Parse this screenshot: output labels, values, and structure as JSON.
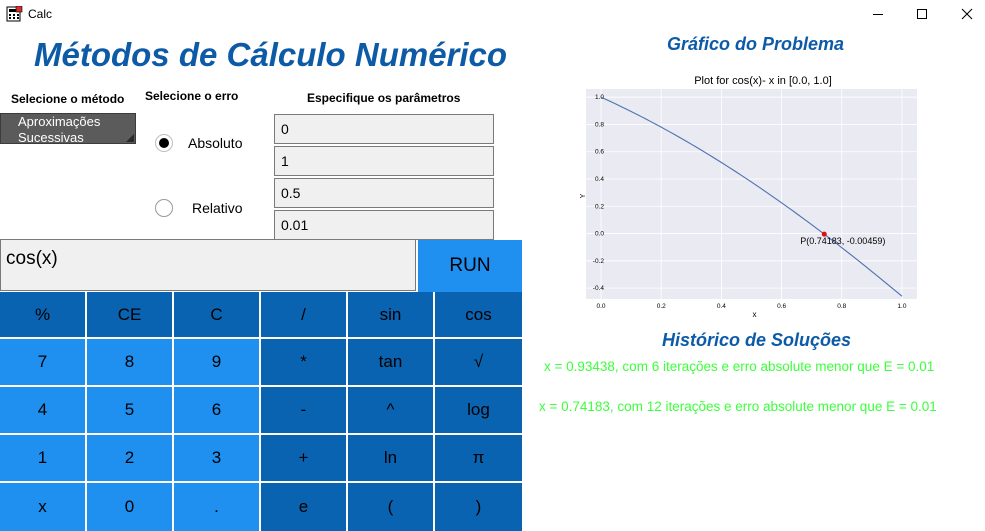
{
  "window": {
    "title": "Calc"
  },
  "main_title": "Métodos de Cálculo Numérico",
  "method": {
    "label": "Selecione o método",
    "selected": "Aproximações Sucessivas"
  },
  "error": {
    "label": "Selecione o erro",
    "options": [
      "Absoluto",
      "Relativo"
    ],
    "selected": "Absoluto"
  },
  "params": {
    "label": "Especifique os parâmetros",
    "values": [
      "0",
      "1",
      "0.5",
      "0.01"
    ]
  },
  "expression": "cos(x)",
  "run_label": "RUN",
  "keypad": {
    "rows": [
      [
        "%",
        "CE",
        "C",
        "/",
        "sin",
        "cos"
      ],
      [
        "7",
        "8",
        "9",
        "*",
        "tan",
        "√"
      ],
      [
        "4",
        "5",
        "6",
        "-",
        "^",
        "log"
      ],
      [
        "1",
        "2",
        "3",
        "+",
        "ln",
        "π"
      ],
      [
        "x",
        "0",
        ".",
        "e",
        "(",
        ")"
      ]
    ]
  },
  "plot_section_title": "Gráfico do Problema",
  "chart_data": {
    "type": "line",
    "title": "Plot for cos(x)- x in [0.0, 1.0]",
    "xlabel": "x",
    "ylabel": "Y",
    "xlim": [
      -0.05,
      1.05
    ],
    "ylim": [
      -0.48,
      1.06
    ],
    "xticks": [
      "0.0",
      "0.2",
      "0.4",
      "0.6",
      "0.8",
      "1.0"
    ],
    "yticks": [
      "1.0",
      "0.8",
      "0.6",
      "0.4",
      "0.2",
      "0.0",
      "-0.2",
      "-0.4"
    ],
    "grid": true,
    "series": [
      {
        "function": "cos(x) - x",
        "x_range": [
          0.0,
          1.0
        ],
        "color": "#4c72b0"
      }
    ],
    "point": {
      "x": 0.74183,
      "y": -0.00459,
      "label": "P(0.74183, -0.00459)",
      "color": "#e01010"
    }
  },
  "history": {
    "title": "Histórico de Soluções",
    "lines": [
      "x = 0.93438, com 6 iterações e erro absolute menor que E = 0.01",
      "x = 0.74183, com 12 iterações e erro absolute menor que E = 0.01"
    ]
  },
  "colors": {
    "title": "#0d5aa7",
    "key_dark": "#0a63b0",
    "key_light": "#1f8ff0",
    "history": "#3cff3c"
  }
}
